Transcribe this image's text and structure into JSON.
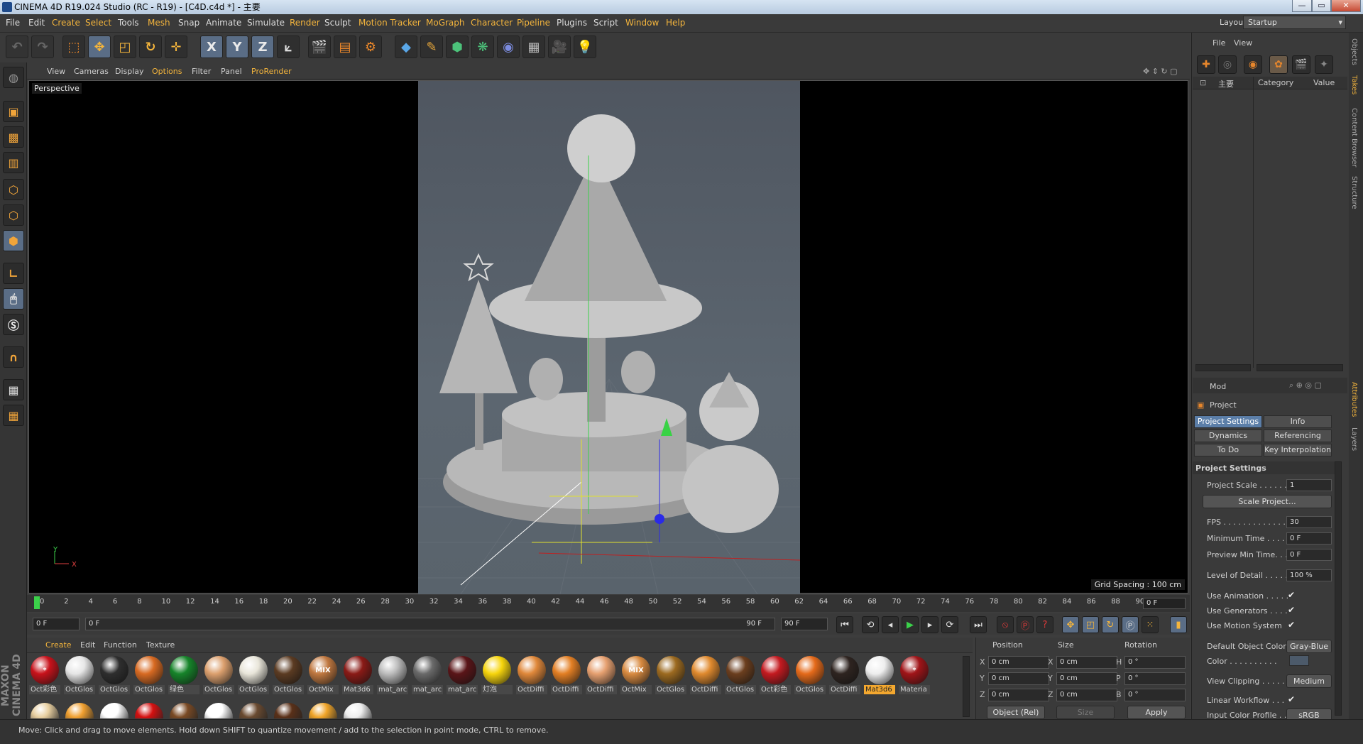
{
  "window": {
    "title": "CINEMA 4D R19.024 Studio (RC - R19) - [C4D.c4d *] - 主要"
  },
  "menu": {
    "items": [
      "File",
      "Edit",
      "Create",
      "Select",
      "Tools",
      "Mesh",
      "Snap",
      "Animate",
      "Simulate",
      "Render",
      "Sculpt",
      "Motion Tracker",
      "MoGraph",
      "Character",
      "Pipeline",
      "Plugins",
      "Script",
      "Window",
      "Help"
    ],
    "layout_label": "Layout:",
    "layout_value": "Startup"
  },
  "toolbar": {
    "axes": [
      "X",
      "Y",
      "Z"
    ]
  },
  "viewport": {
    "menu": [
      "View",
      "Cameras",
      "Display",
      "Options",
      "Filter",
      "Panel",
      "ProRender"
    ],
    "camera_label": "Perspective",
    "grid_spacing": "Grid Spacing : 100 cm",
    "axis_y": "Y",
    "axis_x": "X"
  },
  "timeline": {
    "ticks": [
      "0",
      "2",
      "4",
      "6",
      "8",
      "10",
      "12",
      "14",
      "16",
      "18",
      "20",
      "22",
      "24",
      "26",
      "28",
      "30",
      "32",
      "34",
      "36",
      "38",
      "40",
      "42",
      "44",
      "46",
      "48",
      "50",
      "52",
      "54",
      "56",
      "58",
      "60",
      "62",
      "64",
      "66",
      "68",
      "70",
      "72",
      "74",
      "76",
      "78",
      "80",
      "82",
      "84",
      "86",
      "88",
      "90"
    ],
    "current_frame": "0 F",
    "start_field": "0 F",
    "range_start": "0 F",
    "range_end": "90 F",
    "end_field": "90 F"
  },
  "materials": {
    "menu": [
      "Create",
      "Edit",
      "Function",
      "Texture"
    ],
    "row1": [
      {
        "label": "Oct彩色",
        "color": "#c8121b",
        "icon": "*"
      },
      {
        "label": "OctGlos",
        "color": "#e6e6e6"
      },
      {
        "label": "OctGlos",
        "color": "#2e2e2e"
      },
      {
        "label": "OctGlos",
        "color": "#d86a22"
      },
      {
        "label": "绿色",
        "color": "#16842a"
      },
      {
        "label": "OctGlos",
        "color": "#dca06e"
      },
      {
        "label": "OctGlos",
        "color": "#e9e6da"
      },
      {
        "label": "OctGlos",
        "color": "#5b3b22"
      },
      {
        "label": "OctMix",
        "color": "#c07840",
        "icon": "MIX"
      },
      {
        "label": "Mat3d6",
        "color": "#8a1a16"
      },
      {
        "label": "mat_arc",
        "color": "#bdbdbd"
      },
      {
        "label": "mat_arc",
        "color": "#6a6a6a"
      },
      {
        "label": "mat_arc",
        "color": "#5a1518"
      },
      {
        "label": "灯泡",
        "color": "#f7d50c"
      },
      {
        "label": "OctDiffi",
        "color": "#e0883a"
      },
      {
        "label": "OctDiffi",
        "color": "#e37f24"
      },
      {
        "label": "OctDiffi",
        "color": "#e6a070"
      },
      {
        "label": "OctMix",
        "color": "#d88a40",
        "icon": "MIX"
      },
      {
        "label": "OctGlos",
        "color": "#9c6a20"
      },
      {
        "label": "OctDiffi",
        "color": "#e08a2e"
      },
      {
        "label": "OctGlos",
        "color": "#6b3e1e"
      },
      {
        "label": "Oct彩色",
        "color": "#c41a20"
      },
      {
        "label": "OctGlos",
        "color": "#e56a1a"
      },
      {
        "label": "OctDiffi",
        "color": "#2e2420"
      },
      {
        "label": "Mat3d6",
        "color": "#eeeeee",
        "selected": true
      },
      {
        "label": "Materia",
        "color": "#a01418",
        "icon": "*"
      }
    ],
    "row2_colors": [
      "#e8cfa0",
      "#f0a030",
      "#ffffff",
      "#d41010",
      "#7a4a24",
      "#ffffff",
      "#6a4a30",
      "#5a3018",
      "#f0a428",
      "#eeeeee"
    ]
  },
  "coordinates": {
    "headers": [
      "Position",
      "Size",
      "Rotation"
    ],
    "rows": [
      {
        "a": "X",
        "pos": "0 cm",
        "b": "X",
        "size": "0 cm",
        "c": "H",
        "rot": "0 °"
      },
      {
        "a": "Y",
        "pos": "0 cm",
        "b": "Y",
        "size": "0 cm",
        "c": "P",
        "rot": "0 °"
      },
      {
        "a": "Z",
        "pos": "0 cm",
        "b": "Z",
        "size": "0 cm",
        "c": "B",
        "rot": "0 °"
      }
    ],
    "mode": "Object (Rel)",
    "size_mode": "Size",
    "apply": "Apply"
  },
  "objects_panel": {
    "menu": [
      "File",
      "View"
    ],
    "col_take": "主要",
    "col_category": "Category",
    "col_value": "Value"
  },
  "attributes": {
    "mode": "Mod",
    "title": "Project",
    "tabs": [
      "Project Settings",
      "Info",
      "Dynamics",
      "Referencing",
      "To Do",
      "Key Interpolation"
    ],
    "section": "Project Settings",
    "scale_project": "Scale Project...",
    "rows": [
      {
        "label": "Project Scale . . . . . .",
        "value": "1"
      },
      {
        "label": "FPS . . . . . . . . . . . . . . .",
        "value": "30"
      },
      {
        "label": "Minimum Time . . . .",
        "value": "0 F"
      },
      {
        "label": "Preview Min Time. . .",
        "value": "0 F"
      },
      {
        "label": "Level of Detail . . . . .",
        "value": "100 %"
      }
    ],
    "checks": [
      {
        "label": "Use Animation . . . . .",
        "value": "✔"
      },
      {
        "label": "Use Generators . . . .",
        "value": "✔"
      },
      {
        "label": "Use Motion System",
        "value": "✔"
      }
    ],
    "default_object_color_label": "Default Object Color",
    "default_object_color": "Gray-Blue",
    "color_label": "Color . . . . . . . . . .",
    "view_clipping_label": "View Clipping . . . . .",
    "view_clipping": "Medium",
    "linear_workflow_label": "Linear Workflow . . .",
    "linear_workflow": "✔",
    "input_color_profile_label": "Input Color Profile . .",
    "input_color_profile": "sRGB"
  },
  "side_tabs": [
    "Objects",
    "Takes",
    "Content Browser",
    "Structure",
    "Attributes",
    "Layers"
  ],
  "status": "Move: Click and drag to move elements. Hold down SHIFT to quantize movement / add to the selection in point mode, CTRL to remove.",
  "logo": "MAXON CINEMA 4D",
  "colors": {
    "accent": "#f3b43c",
    "selected_tab": "#5b7ea8"
  }
}
